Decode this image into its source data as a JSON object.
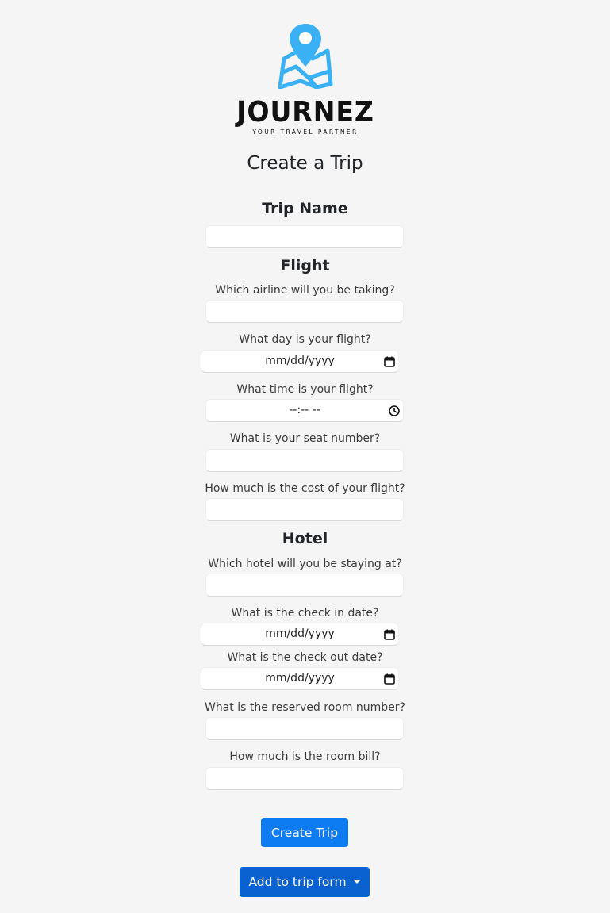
{
  "brand": {
    "name": "JOURNEZ",
    "tagline": "YOUR TRAVEL PARTNER",
    "icon": "map-pin-icon",
    "accent_color": "#3ab0f5"
  },
  "page_title": "Create a Trip",
  "trip": {
    "section_title": "Trip Name",
    "name_value": ""
  },
  "flight": {
    "section_title": "Flight",
    "airline_label": "Which airline will you be taking?",
    "airline_value": "",
    "date_label": "What day is your flight?",
    "date_placeholder": "mm/dd/yyyy",
    "time_label": "What time is your flight?",
    "time_placeholder": "--:-- --",
    "seat_label": "What is your seat number?",
    "seat_value": "",
    "cost_label": "How much is the cost of your flight?",
    "cost_value": ""
  },
  "hotel": {
    "section_title": "Hotel",
    "hotel_label": "Which hotel will you be staying at?",
    "hotel_value": "",
    "checkin_label": "What is the check in date?",
    "checkin_placeholder": "mm/dd/yyyy",
    "checkout_label": "What is the check out date?",
    "checkout_placeholder": "mm/dd/yyyy",
    "room_label": "What is the reserved room number?",
    "room_value": "",
    "bill_label": "How much is the room bill?",
    "bill_value": ""
  },
  "actions": {
    "create_label": "Create Trip",
    "add_label": "Add to trip form"
  },
  "colors": {
    "background": "#f5f5f5",
    "primary_button": "#0d7cf2",
    "dropdown_button": "#0a62d0"
  }
}
